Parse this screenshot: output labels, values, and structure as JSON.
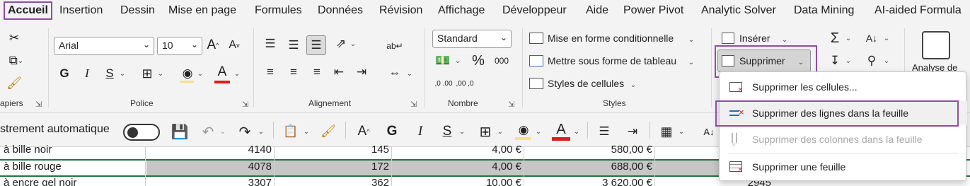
{
  "tabs": [
    "Accueil",
    "Insertion",
    "Dessin",
    "Mise en page",
    "Formules",
    "Données",
    "Révision",
    "Affichage",
    "Développeur",
    "Aide",
    "Power Pivot",
    "Analytic Solver",
    "Data Mining",
    "AI-aided Formula"
  ],
  "ribbon": {
    "clipboard_label": "apiers",
    "font": {
      "name": "Arial",
      "size": "10",
      "group_label": "Police",
      "bold": "G",
      "italic": "I",
      "underline": "S",
      "grow": "A",
      "shrink": "A"
    },
    "alignment": {
      "group_label": "Alignement"
    },
    "number": {
      "format": "Standard",
      "percent": "%",
      "thousands": "000",
      "group_label": "Nombre",
      "inc_decimal": ",0 .00",
      "dec_decimal": ",00 ,0"
    },
    "styles": {
      "conditional": "Mise en forme conditionnelle",
      "as_table": "Mettre sous forme de tableau",
      "cell_styles": "Styles de cellules",
      "group_label": "Styles"
    },
    "cells": {
      "insert": "Insérer",
      "delete": "Supprimer"
    },
    "analyze": {
      "label": "Analyse de"
    }
  },
  "qat": {
    "autosave": "strement automatique",
    "grow": "A",
    "bold": "G",
    "italic": "I",
    "underline": "S"
  },
  "rows": [
    {
      "name": "à bille noir",
      "c1": "4140",
      "c2": "145",
      "c3": "4,00 €",
      "c4": "580,00 €"
    },
    {
      "name": "à bille rouge",
      "c1": "4078",
      "c2": "172",
      "c3": "4,00 €",
      "c4": "688,00 €"
    },
    {
      "name": "à encre gel noir",
      "c1": "3307",
      "c2": "362",
      "c3": "10,00 €",
      "c4": "3 620,00 €",
      "c5": "2945"
    }
  ],
  "dropdown": {
    "items": [
      {
        "label": "Supprimer les cellules...",
        "enabled": true
      },
      {
        "label": "Supprimer des lignes dans la feuille",
        "enabled": true
      },
      {
        "label": "Supprimer des colonnes dans la feuille",
        "enabled": false
      },
      {
        "label": "Supprimer une feuille",
        "enabled": true
      }
    ]
  },
  "colors": {
    "highlight": "#8f4ea2",
    "font_red": "#e01b1b",
    "fill_yellow": "#f7e08a",
    "selected_row": "#c6c6c6",
    "row_border": "#217346"
  }
}
